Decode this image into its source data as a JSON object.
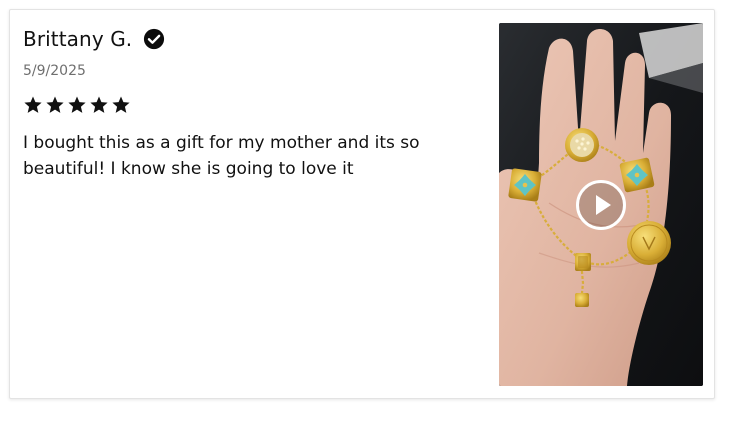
{
  "review": {
    "author": "Brittany G.",
    "verified_icon": "verified-check-icon",
    "date": "5/9/2025",
    "rating": 5,
    "rating_max": 5,
    "star_color": "#111111",
    "body": "I bought this as a gift for my mother and its so beautiful! I know she is going to love it"
  },
  "media": {
    "type": "video",
    "play_icon": "play-icon",
    "thumbnail_subject": "hand holding a gold bracelet with turquoise clover charms"
  }
}
